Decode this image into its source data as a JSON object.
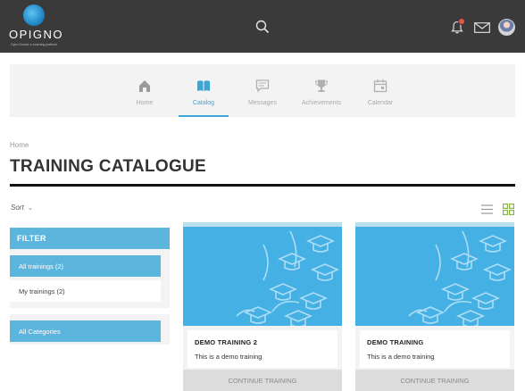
{
  "header": {
    "logo_text": "OPIGNO",
    "logo_tagline": "Open Source e-Learning platform",
    "notification_count": "1"
  },
  "nav": {
    "items": [
      {
        "label": "Home",
        "icon": "home-icon"
      },
      {
        "label": "Catalog",
        "icon": "book-icon",
        "active": true
      },
      {
        "label": "Messages",
        "icon": "chat-icon"
      },
      {
        "label": "Achievements",
        "icon": "trophy-icon"
      },
      {
        "label": "Calendar",
        "icon": "calendar-icon"
      }
    ]
  },
  "breadcrumb": "Home",
  "page_title": "TRAINING CATALOGUE",
  "sort_label": "Sort",
  "filter": {
    "heading": "FILTER",
    "options": [
      {
        "label": "All trainings (2)",
        "active": true
      },
      {
        "label": "My trainings (2)",
        "active": false
      }
    ],
    "categories_label": "All Categories"
  },
  "cards": [
    {
      "title": "DEMO TRAINING 2",
      "description": "This is a demo training",
      "button": "CONTINUE TRAINING"
    },
    {
      "title": "DEMO TRAINING",
      "description": "This is a demo training",
      "button": "CONTINUE TRAINING"
    }
  ],
  "colors": {
    "topbar": "#3a3a3a",
    "accent": "#3fa6d4",
    "filter_blue": "#5bb5dc",
    "card_image": "#45b0e3",
    "badge": "#e8534a"
  }
}
